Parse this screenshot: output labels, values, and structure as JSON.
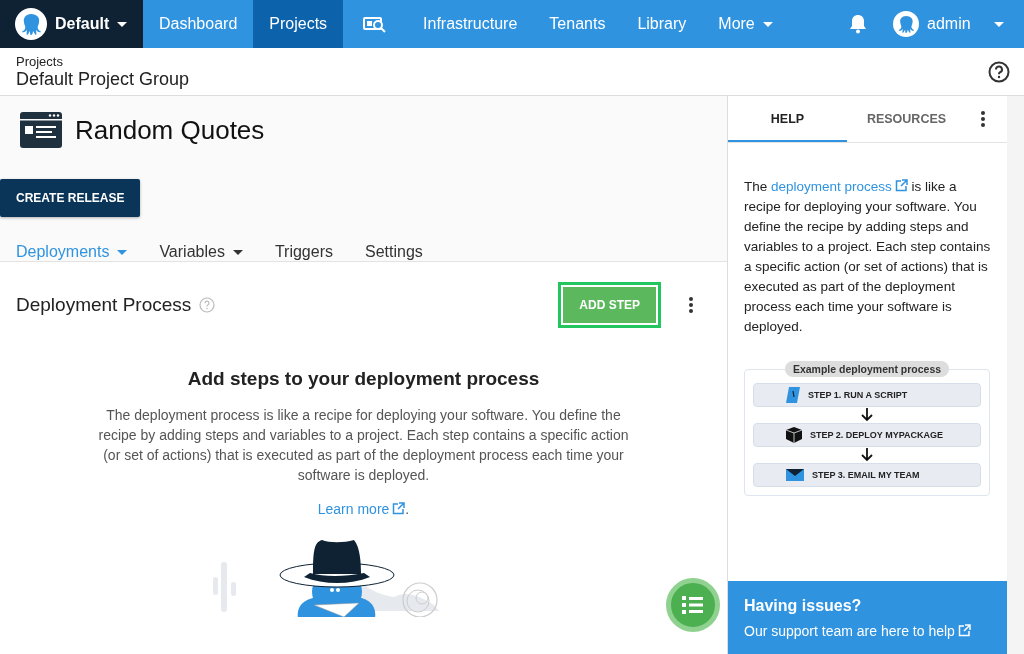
{
  "nav": {
    "brand": "Default",
    "items": [
      {
        "kind": "text",
        "label": "Dashboard",
        "selected": false,
        "dropdown": false
      },
      {
        "kind": "text",
        "label": "Projects",
        "selected": true,
        "dropdown": false
      },
      {
        "kind": "icon",
        "selected": false,
        "dropdown": false
      },
      {
        "kind": "text",
        "label": "Infrastructure",
        "selected": false,
        "dropdown": false
      },
      {
        "kind": "text",
        "label": "Tenants",
        "selected": false,
        "dropdown": false
      },
      {
        "kind": "text",
        "label": "Library",
        "selected": false,
        "dropdown": false
      },
      {
        "kind": "text",
        "label": "More",
        "selected": false,
        "dropdown": true
      }
    ],
    "user": "admin"
  },
  "breadcrumb": {
    "parent": "Projects",
    "title": "Default Project Group"
  },
  "project": {
    "name": "Random Quotes",
    "create_button": "CREATE RELEASE"
  },
  "tabs": [
    {
      "label": "Deployments",
      "selected": true,
      "dropdown": true
    },
    {
      "label": "Variables",
      "selected": false,
      "dropdown": true
    },
    {
      "label": "Triggers",
      "selected": false,
      "dropdown": false
    },
    {
      "label": "Settings",
      "selected": false,
      "dropdown": false
    }
  ],
  "process": {
    "title": "Deployment Process",
    "add_button": "ADD STEP",
    "empty_heading": "Add steps to your deployment process",
    "empty_text": "The deployment process is like a recipe for deploying your software. You define the recipe by adding steps and variables to a project. Each step contains a specific action (or set of actions) that is executed as part of the deployment process each time your software is deployed.",
    "learn_more": "Learn more",
    "learn_more_suffix": "."
  },
  "help": {
    "tabs": [
      {
        "label": "HELP",
        "selected": true
      },
      {
        "label": "RESOURCES",
        "selected": false
      }
    ],
    "text_before": "The ",
    "link": "deployment process",
    "text_after": " is like a recipe for deploying your software. You define the recipe by adding steps and variables to a project. Each step contains a specific action (or set of actions) that is executed as part of the deployment process each time your software is deployed.",
    "example": {
      "title": "Example deployment process",
      "steps": [
        {
          "kind": "script",
          "label": "STEP 1. RUN A SCRIPT"
        },
        {
          "kind": "package",
          "label": "STEP 2. DEPLOY MYPACKAGE"
        },
        {
          "kind": "email",
          "label": "STEP 3. EMAIL MY TEAM"
        }
      ]
    },
    "issues": {
      "title": "Having issues?",
      "link": "Our support team are here to help"
    }
  }
}
